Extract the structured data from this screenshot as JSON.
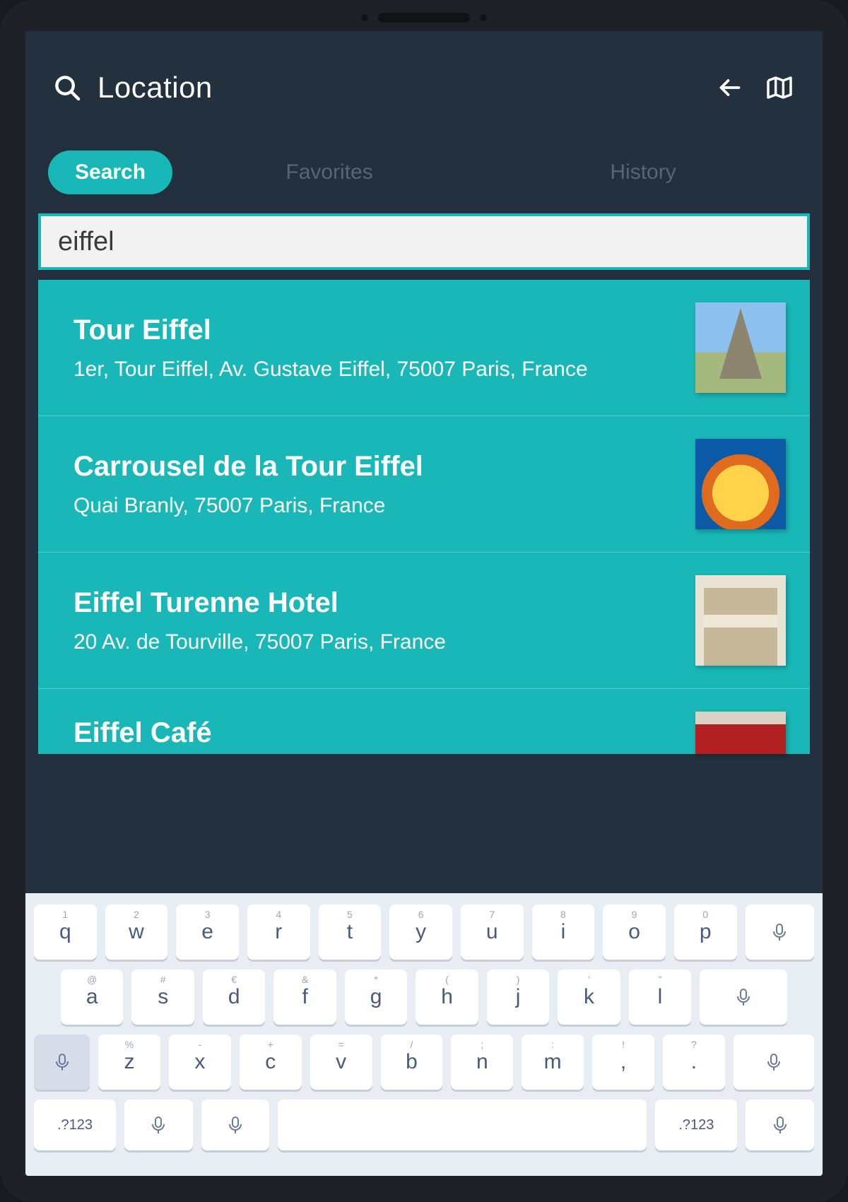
{
  "header": {
    "title": "Location"
  },
  "tabs": {
    "search": "Search",
    "favorites": "Favorites",
    "history": "History",
    "active": "search"
  },
  "search": {
    "value": "eiffel",
    "placeholder": ""
  },
  "results": [
    {
      "title": "Tour Eiffel",
      "address": "1er, Tour Eiffel, Av. Gustave Eiffel, 75007 Paris, France",
      "thumb": "eiffel"
    },
    {
      "title": "Carrousel de la Tour Eiffel",
      "address": "Quai Branly, 75007 Paris, France",
      "thumb": "carousel"
    },
    {
      "title": "Eiffel Turenne Hotel",
      "address": "20 Av. de Tourville, 75007 Paris, France",
      "thumb": "hotel"
    },
    {
      "title": "Eiffel Café",
      "address": "",
      "thumb": "cafe",
      "short": true
    }
  ],
  "keyboard": {
    "row1": [
      {
        "main": "q",
        "sub": "1"
      },
      {
        "main": "w",
        "sub": "2"
      },
      {
        "main": "e",
        "sub": "3"
      },
      {
        "main": "r",
        "sub": "4"
      },
      {
        "main": "t",
        "sub": "5"
      },
      {
        "main": "y",
        "sub": "6"
      },
      {
        "main": "u",
        "sub": "7"
      },
      {
        "main": "i",
        "sub": "8"
      },
      {
        "main": "o",
        "sub": "9"
      },
      {
        "main": "p",
        "sub": "0"
      },
      {
        "mic": true
      }
    ],
    "row2": [
      {
        "main": "a",
        "sub": "@"
      },
      {
        "main": "s",
        "sub": "#"
      },
      {
        "main": "d",
        "sub": "€"
      },
      {
        "main": "f",
        "sub": "&"
      },
      {
        "main": "g",
        "sub": "*"
      },
      {
        "main": "h",
        "sub": "("
      },
      {
        "main": "j",
        "sub": ")"
      },
      {
        "main": "k",
        "sub": "'"
      },
      {
        "main": "l",
        "sub": "\""
      },
      {
        "mic": true
      }
    ],
    "row3": [
      {
        "mic": true,
        "gray": true
      },
      {
        "main": "z",
        "sub": "%"
      },
      {
        "main": "x",
        "sub": "-"
      },
      {
        "main": "c",
        "sub": "+"
      },
      {
        "main": "v",
        "sub": "="
      },
      {
        "main": "b",
        "sub": "/"
      },
      {
        "main": "n",
        "sub": ";"
      },
      {
        "main": "m",
        "sub": ":"
      },
      {
        "main": ",",
        "sub": "!"
      },
      {
        "main": ".",
        "sub": "?"
      },
      {
        "mic": true
      }
    ],
    "row4": {
      "fn": ".?123"
    }
  },
  "colors": {
    "accent": "#19b7b7",
    "bg_dark": "#23303d"
  }
}
